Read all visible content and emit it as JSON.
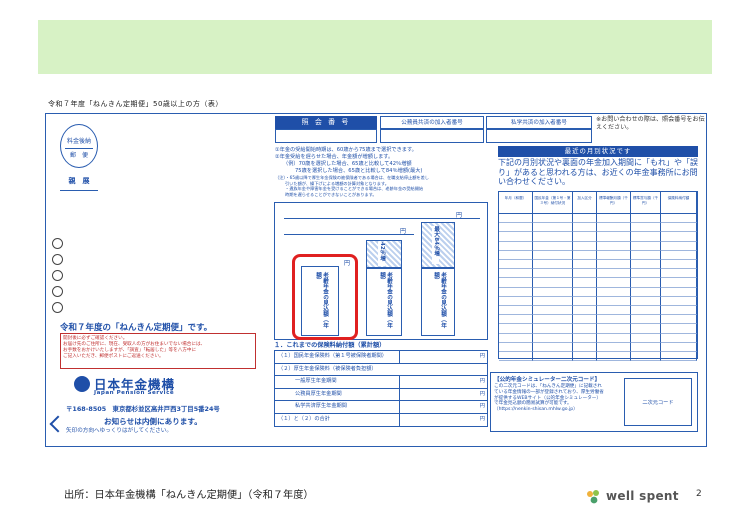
{
  "header": {
    "doc_title": "令和７年度「ねんきん定期便」50歳以上の方（表）"
  },
  "left": {
    "stamp_line1": "料金後納",
    "stamp_line2": "郵　便",
    "shinsho": "親　展",
    "campaign_title": "令和７年度の「ねんきん定期便」です。",
    "notice_lines": [
      "開封後に必ずご確認ください。",
      "お届け先のご住所に、現在、受取人の方がお住まいでない場合には、",
      "お手数をおかけいたしますが、「調査」「転居した」等を八方中に",
      "ご記入いただき、郵便ポストにご返送ください。"
    ],
    "org_name": "日本年金機構",
    "org_name_en": "Japan Pension Service",
    "address": "〒168-8505　東京都杉並区高井戸西3丁目5番24号",
    "inside_notice": "お知らせは内側にあります。",
    "inside_sub": "矢印の方向へゆっくりはがしてください。"
  },
  "center": {
    "shokai_label": "照 会 番 号",
    "kyosai_public": "公務員共済の加入者番号",
    "kyosai_private": "私学共済の加入者番号",
    "contact_note": "※お問い合わせの際は、照会番号をお伝えください。",
    "notes_lines": [
      "①年金の受給開始時期は、60歳から75歳まで選択できます。",
      "②年金受給を遅らせた場合、年金額が増額します。",
      "（例）70歳を選択した場合、65歳と比較して42％増額",
      "75歳を選択した場合、65歳と比較して84％増額(最大)"
    ],
    "notes_small": [
      "（注）・65歳以降で厚生年金保険の被保険者である場合は、在職支給停止額を差し",
      "引いた額が、繰下げによる増額の計算対象となります。",
      "・遺族年金や障害年金を受けることができる場合は、老齢年金の受給開始",
      "時期を遅らせることができないことがあります。"
    ],
    "bars": [
      {
        "vtext": "老齢年金の見込額（年額）",
        "pct": "",
        "yen": "円"
      },
      {
        "vtext": "老齢年金の見込額（年額）",
        "pct": "42％増",
        "yen": "円"
      },
      {
        "vtext": "老齢年金の見込額（年額）",
        "pct": "最大84％増",
        "yen": "円"
      }
    ],
    "premium_section_title": "１．これまでの保険料納付額（累計額）",
    "premium_rows": [
      {
        "label": "（１）国民年金保険料（第１号被保険者期間）",
        "yen": "円"
      },
      {
        "label": "（２）厚生年金保険料（被保険者負担額）",
        "yen": ""
      },
      {
        "label": "一般厚生年金期間",
        "yen": "円"
      },
      {
        "label": "公務員厚生年金期間",
        "yen": "円"
      },
      {
        "label": "私学共済厚生年金期間",
        "yen": "円"
      },
      {
        "label": "（１）と（２）の合計",
        "yen": "円"
      }
    ]
  },
  "right": {
    "recent_head": "最近の月別状況です",
    "recent_text": "下記の月別状況や裏面の年金加入期間に「もれ」や「誤り」があると思われる方は、お近くの年金事務所にお問い合わせください。",
    "table_headers": [
      "年月（和暦）",
      "国民年金（第１号・第３号）納付状況",
      "加入区分",
      "標準報酬月額（千円）",
      "標準賞与額（千円）",
      "保険料納付額"
    ],
    "sim_title": "【公的年金シミュレーター二次元コード】",
    "sim_text": "この二次元コードは、「ねんきん定期便」に記載されている年金情報の一部が登録されており、厚生労働省が提供するWEBサイト（公的年金シミュレーター）で年金見込額の簡易試算が可能です。（https://nenkin-shisan.mhlw.go.jp）",
    "qr_label": "二次元コード"
  },
  "footer": {
    "source": "出所：日本年金機構「ねんきん定期便」（令和７年度）",
    "brand": "well spent",
    "page": "2"
  }
}
